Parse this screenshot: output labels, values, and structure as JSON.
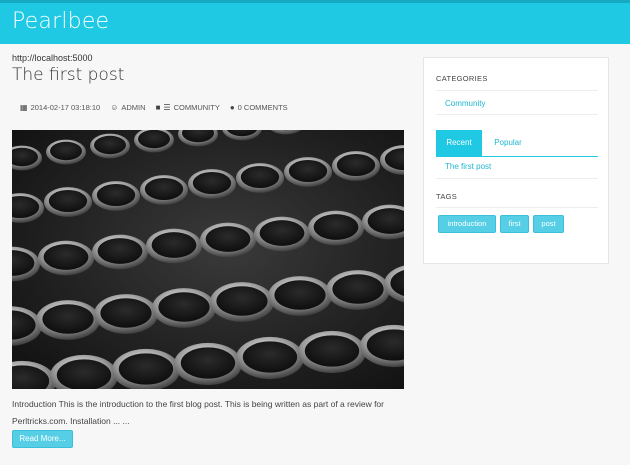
{
  "navbar": {
    "brand": "Pearlbee"
  },
  "main": {
    "site_url": "http://localhost:5000",
    "post": {
      "title": "The first post",
      "meta": {
        "date": "2014-02-17 03:18:10",
        "author": "ADMIN",
        "category": "COMMUNITY",
        "comments": "0 COMMENTS"
      },
      "image_subject": "typewriter keys photograph",
      "excerpt_line1": "Introduction This is the introduction to the first blog post. This is being written as part of a review for",
      "excerpt_line2": "Perltricks.com. Installation ... ...",
      "read_more_label": "Read More..."
    }
  },
  "sidebar": {
    "categories_heading": "CATEGORIES",
    "categories": [
      "Community"
    ],
    "tabs": [
      {
        "label": "Recent",
        "active": true
      },
      {
        "label": "Popular",
        "active": false
      }
    ],
    "recent_posts": [
      "The first post"
    ],
    "tags_heading": "TAGS",
    "tags": [
      "introduction",
      "first",
      "post"
    ]
  },
  "colors": {
    "accent": "#1fc8e3",
    "link": "#1fb7d1",
    "button": "#56cfe6"
  }
}
